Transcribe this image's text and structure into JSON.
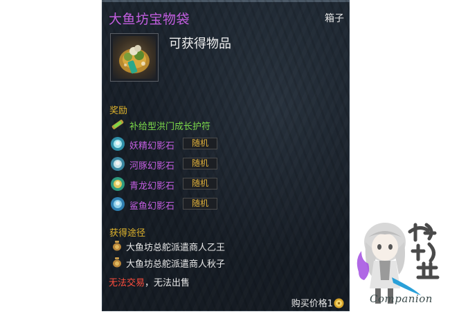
{
  "item": {
    "name": "大鱼坊宝物袋",
    "category": "箱子",
    "icon": "treasure-bag-icon",
    "obtain_label": "可获得物品"
  },
  "rewards": {
    "heading": "奖励",
    "items": [
      {
        "name": "补给型洪门成长护符",
        "icon": "scroll-talisman-icon",
        "color": "#7cd94a",
        "badge": ""
      },
      {
        "name": "妖精幻影石",
        "icon": "phantom-stone-icon",
        "color": "#c35ee0",
        "badge": "随机"
      },
      {
        "name": "河豚幻影石",
        "icon": "phantom-stone-icon",
        "color": "#c35ee0",
        "badge": "随机"
      },
      {
        "name": "青龙幻影石",
        "icon": "phantom-stone-icon",
        "color": "#c35ee0",
        "badge": "随机"
      },
      {
        "name": "鲨鱼幻影石",
        "icon": "phantom-stone-icon",
        "color": "#c35ee0",
        "badge": "随机"
      }
    ]
  },
  "sources": {
    "heading": "获得途径",
    "items": [
      {
        "text": "大鱼坊总舵派遣商人乙王",
        "icon": "money-bag-icon"
      },
      {
        "text": "大鱼坊总舵派遣商人秋子",
        "icon": "money-bag-icon"
      }
    ]
  },
  "trade": {
    "restriction": "无法交易",
    "separator": "，",
    "sell": "无法出售"
  },
  "price": {
    "label": "购买价格1",
    "icon": "gold-coin-icon"
  },
  "watermark": {
    "logo_text": "攻略組",
    "label": "Companion"
  },
  "colors": {
    "title": "#c35ee0",
    "heading": "#e0b42c",
    "green_item": "#7cd94a",
    "purple_item": "#c35ee0",
    "badge_text": "#e2b13a",
    "restriction": "#ff4d3d"
  }
}
